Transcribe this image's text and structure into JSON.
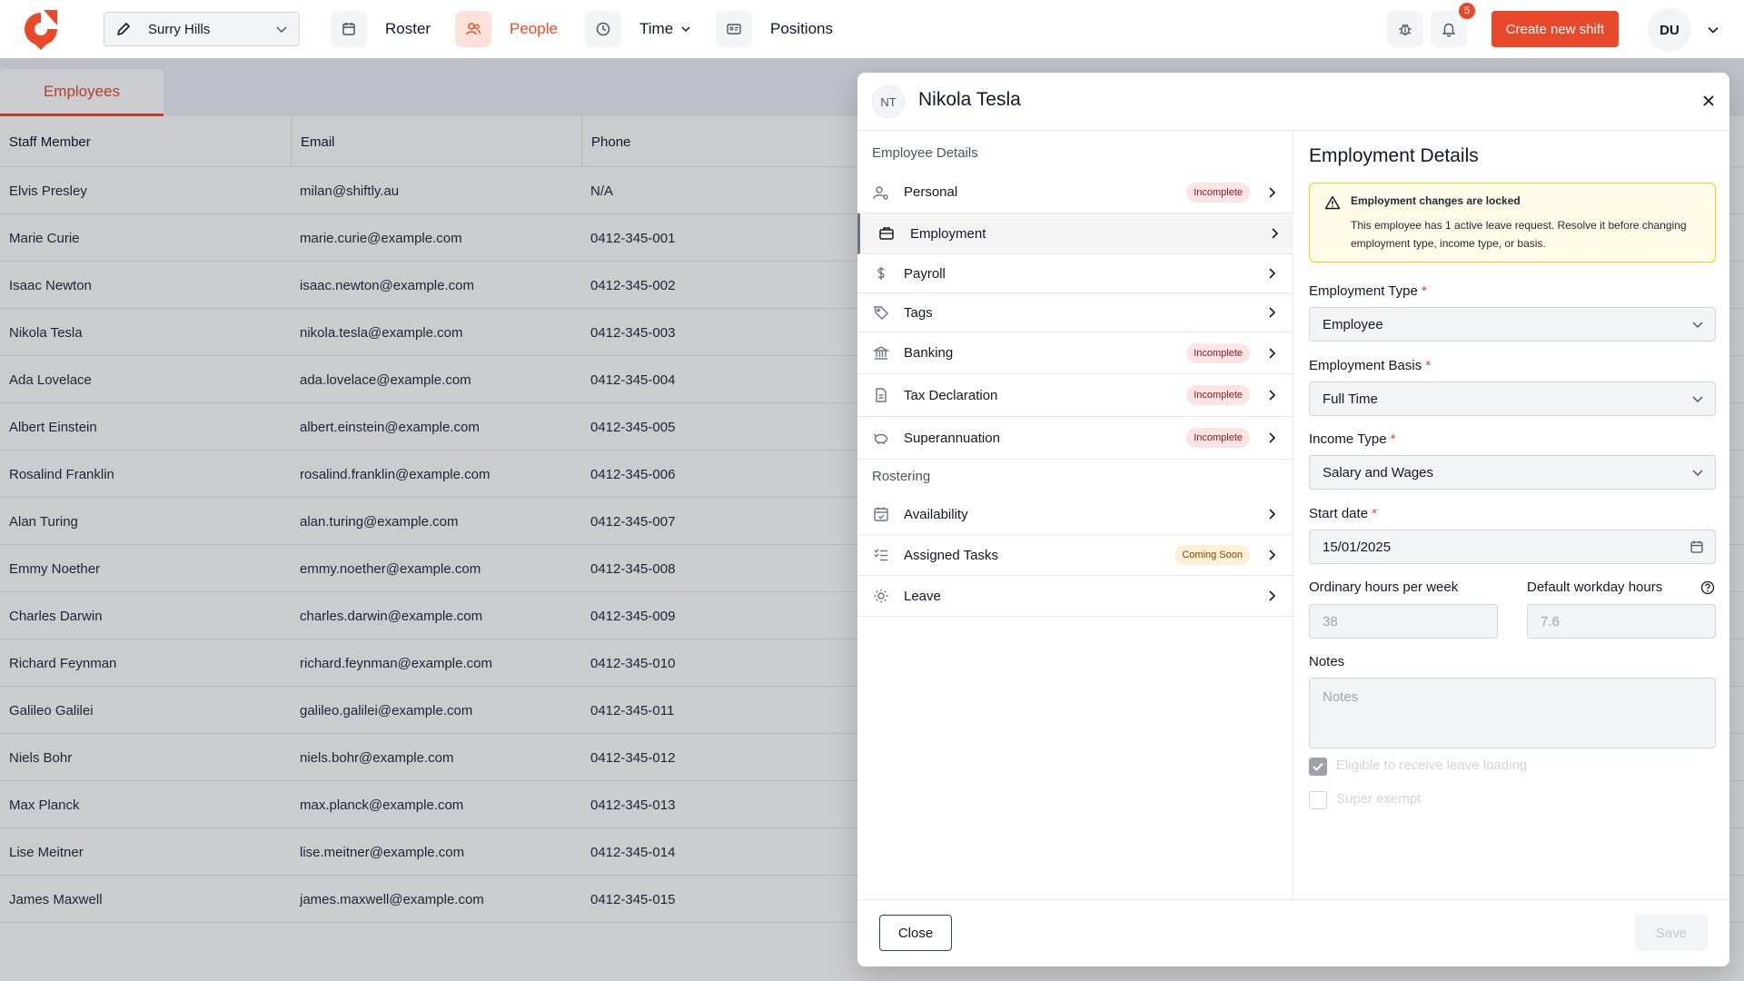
{
  "topnav": {
    "location": "Surry Hills",
    "nav": [
      {
        "label": "Roster",
        "icon": "calendar-icon"
      },
      {
        "label": "People",
        "icon": "people-icon",
        "active": true
      },
      {
        "label": "Time",
        "icon": "clock-icon"
      },
      {
        "label": "Positions",
        "icon": "id-card-icon"
      }
    ],
    "notifications_count": "5",
    "create_label": "Create new shift",
    "user_initials": "DU",
    "accent": "#e8492a"
  },
  "list": {
    "tab_label": "Employees",
    "columns": [
      "Staff Member",
      "Email",
      "Phone"
    ],
    "rows": [
      [
        "Elvis Presley",
        "milan@shiftly.au",
        "N/A"
      ],
      [
        "Marie Curie",
        "marie.curie@example.com",
        "0412-345-001"
      ],
      [
        "Isaac Newton",
        "isaac.newton@example.com",
        "0412-345-002"
      ],
      [
        "Nikola Tesla",
        "nikola.tesla@example.com",
        "0412-345-003"
      ],
      [
        "Ada Lovelace",
        "ada.lovelace@example.com",
        "0412-345-004"
      ],
      [
        "Albert Einstein",
        "albert.einstein@example.com",
        "0412-345-005"
      ],
      [
        "Rosalind Franklin",
        "rosalind.franklin@example.com",
        "0412-345-006"
      ],
      [
        "Alan Turing",
        "alan.turing@example.com",
        "0412-345-007"
      ],
      [
        "Emmy Noether",
        "emmy.noether@example.com",
        "0412-345-008"
      ],
      [
        "Charles Darwin",
        "charles.darwin@example.com",
        "0412-345-009"
      ],
      [
        "Richard Feynman",
        "richard.feynman@example.com",
        "0412-345-010"
      ],
      [
        "Galileo Galilei",
        "galileo.galilei@example.com",
        "0412-345-011"
      ],
      [
        "Niels Bohr",
        "niels.bohr@example.com",
        "0412-345-012"
      ],
      [
        "Max Planck",
        "max.planck@example.com",
        "0412-345-013"
      ],
      [
        "Lise Meitner",
        "lise.meitner@example.com",
        "0412-345-014"
      ],
      [
        "James Maxwell",
        "james.maxwell@example.com",
        "0412-345-015"
      ]
    ]
  },
  "modal": {
    "initials": "NT",
    "name": "Nikola Tesla",
    "employee_details_title": "Employee Details",
    "employee_menu": [
      {
        "label": "Personal",
        "icon": "user-settings-icon",
        "badge": "Incomplete"
      },
      {
        "label": "Employment",
        "icon": "briefcase-icon",
        "badge": "",
        "active": true
      },
      {
        "label": "Payroll",
        "icon": "dollar-icon",
        "badge": ""
      },
      {
        "label": "Tags",
        "icon": "tag-icon",
        "badge": ""
      },
      {
        "label": "Banking",
        "icon": "bank-icon",
        "badge": "Incomplete"
      },
      {
        "label": "Tax Declaration",
        "icon": "document-icon",
        "badge": "Incomplete"
      },
      {
        "label": "Superannuation",
        "icon": "piggy-bank-icon",
        "badge": "Incomplete"
      }
    ],
    "rostering_title": "Rostering",
    "rostering_menu": [
      {
        "label": "Availability",
        "icon": "calendar-check-icon",
        "badge": ""
      },
      {
        "label": "Assigned Tasks",
        "icon": "task-list-icon",
        "badge": "Coming Soon"
      },
      {
        "label": "Leave",
        "icon": "sun-icon",
        "badge": ""
      }
    ],
    "employment": {
      "title": "Employment Details",
      "alert_title": "Employment changes are locked",
      "alert_body": "This employee has 1 active leave request. Resolve it before changing employment type, income type, or basis.",
      "employment_type_label": "Employment Type",
      "employment_type": "Employee",
      "employment_basis_label": "Employment Basis",
      "employment_basis": "Full Time",
      "income_type_label": "Income Type",
      "income_type": "Salary and Wages",
      "start_date_label": "Start date",
      "start_date": "15/01/2025",
      "ordinary_hours_label": "Ordinary hours per week",
      "ordinary_hours": "38",
      "default_hours_label": "Default workday hours",
      "default_hours": "7.6",
      "notes_label": "Notes",
      "notes_placeholder": "Notes",
      "leave_loading_label": "Eligible to receive leave loading",
      "leave_loading_checked": true,
      "super_exempt_label": "Super exempt",
      "super_exempt_checked": false
    },
    "close_label": "Close",
    "save_label": "Save"
  }
}
